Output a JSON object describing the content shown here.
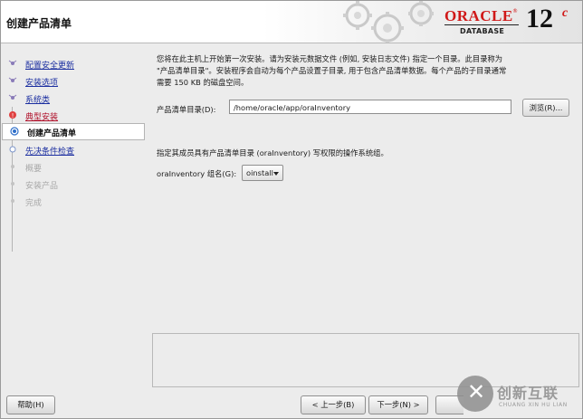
{
  "header": {
    "title": "创建产品清单",
    "logo_oracle": "ORACLE",
    "logo_reg": "®",
    "logo_database": "DATABASE",
    "version": "12",
    "version_suffix": "c"
  },
  "sidebar": {
    "steps": [
      {
        "label": "配置安全更新",
        "state": "done"
      },
      {
        "label": "安装选项",
        "state": "done"
      },
      {
        "label": "系统类",
        "state": "done"
      },
      {
        "label": "典型安装",
        "state": "warning"
      },
      {
        "label": "创建产品清单",
        "state": "current"
      },
      {
        "label": "先决条件检查",
        "state": "next"
      },
      {
        "label": "概要",
        "state": "disabled"
      },
      {
        "label": "安装产品",
        "state": "disabled"
      },
      {
        "label": "完成",
        "state": "disabled"
      }
    ]
  },
  "main": {
    "description_line1": "您将在此主机上开始第一次安装。请为安装元数据文件 (例如, 安装日志文件) 指定一个目录。此目录称为",
    "description_line2": "\"产品清单目录\"。安装程序会自动为每个产品设置子目录, 用于包含产品清单数据。每个产品的子目录通常",
    "description_line3": "需要 150 KB 的磁盘空间。",
    "inventory_label": "产品清单目录(D):",
    "inventory_value": "/home/oracle/app/oraInventory",
    "browse_label": "浏览(R)...",
    "group_description": "指定其成员具有产品清单目录 (oraInventory) 写权限的操作系统组。",
    "group_label": "oraInventory 组名(G):",
    "group_value": "oinstall"
  },
  "footer": {
    "help_label": "帮助(H)",
    "back_label": "< 上一步(B)",
    "next_label": "下一步(N) >"
  },
  "watermark": {
    "text": "创新互联",
    "sub": "CHUANG XIN HU LIAN"
  },
  "colors": {
    "link": "#1b2ea0",
    "warning": "#b0102a",
    "oracle_red": "#d01818"
  }
}
